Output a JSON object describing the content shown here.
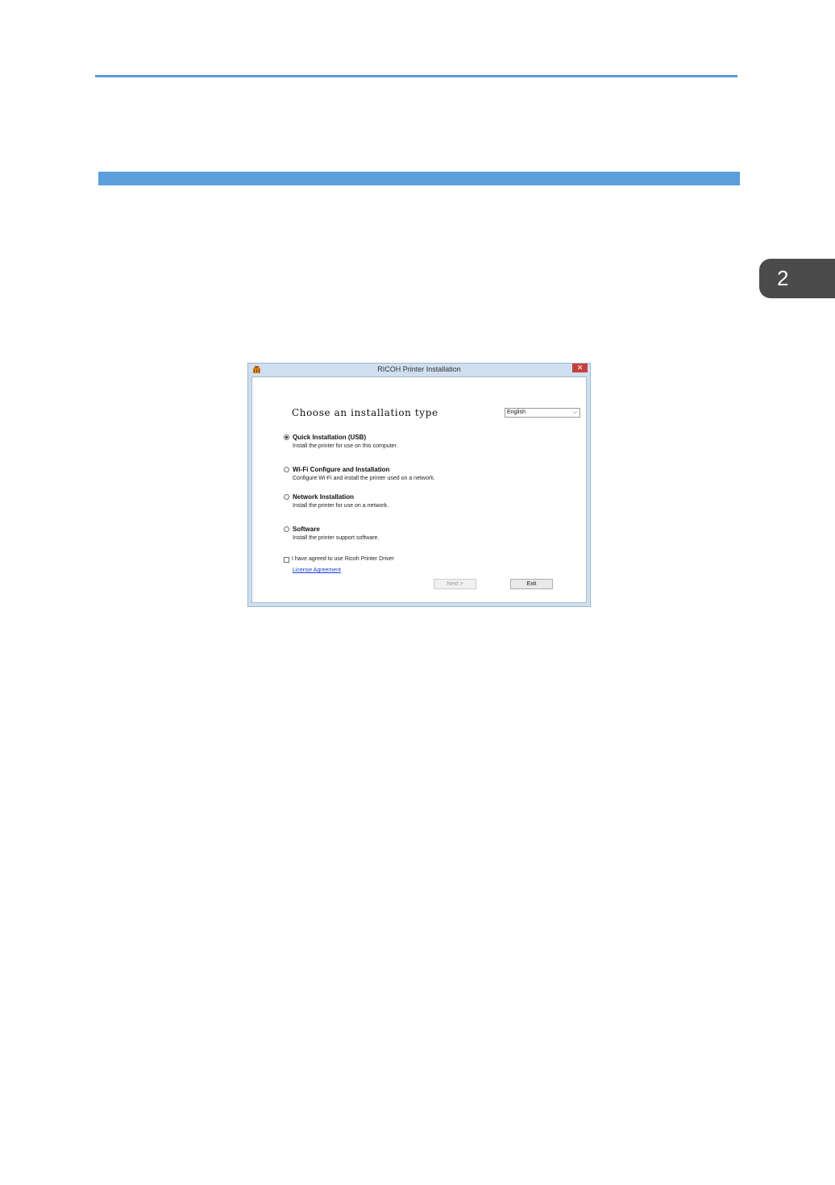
{
  "page": {
    "chapter_number": "2"
  },
  "window": {
    "title": "RICOH Printer Installation",
    "close_glyph": "✕",
    "heading": "Choose an installation type",
    "language_selected": "English",
    "options": [
      {
        "label": "Quick Installation (USB)",
        "description": "Install the printer for use on this computer.",
        "selected": true
      },
      {
        "label": "Wi-Fi Configure and Installation",
        "description": "Configure Wi-Fi and install the printer used on a network.",
        "selected": false
      },
      {
        "label": "Network Installation",
        "description": "Install the printer for use on a network.",
        "selected": false
      },
      {
        "label": "Software",
        "description": "Install the printer support software.",
        "selected": false
      }
    ],
    "agree_label": "I have agreed to use Ricoh Printer Driver",
    "agree_checked": false,
    "license_link": "License Agreement",
    "next_label": "Next >",
    "exit_label": "Exit"
  },
  "colors": {
    "accent_blue": "#5b9fdc",
    "chapter_tab": "#4b4b4b",
    "close_red": "#c9403a",
    "link_blue": "#1a3fd0"
  }
}
